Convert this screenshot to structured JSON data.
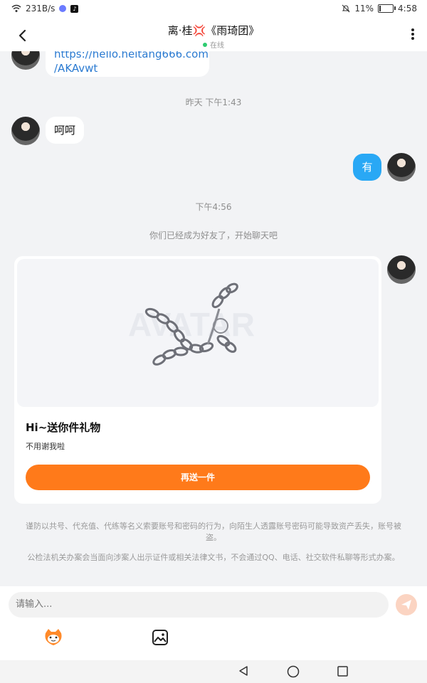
{
  "status_bar": {
    "speed": "231B/s",
    "battery": "11%",
    "time": "4:58",
    "battery_level": 0.11
  },
  "header": {
    "title": "离·桂💢《雨琦团》",
    "status": "在线"
  },
  "messages": [
    {
      "type": "in",
      "lines": [
        "https://hello.heitang666.com",
        "/AKAvwt"
      ]
    },
    {
      "type": "time",
      "text": "昨天 下午1:43"
    },
    {
      "type": "in",
      "text": "呵呵"
    },
    {
      "type": "out",
      "text": "有"
    },
    {
      "type": "time",
      "text": "下午4:56"
    },
    {
      "type": "system",
      "text": "你们已经成为好友了，开始聊天吧"
    }
  ],
  "gift_card": {
    "watermark": "AVATAR",
    "title": "Hi~送你件礼物",
    "desc": "不用谢我啦",
    "button": "再送一件"
  },
  "warnings": [
    "谨防以共号、代充值、代练等名义索要账号和密码的行为，向陌生人透露账号密码可能导致资产丢失，账号被盗。",
    "公检法机关办案会当面向涉案人出示证件或相关法律文书，不会通过QQ、电话、社交软件私聊等形式办案。"
  ],
  "input": {
    "placeholder": "请输入..."
  },
  "colors": {
    "accent_orange": "#ff7a1a",
    "bubble_blue": "#29a8f5",
    "online_green": "#2ecc71"
  }
}
